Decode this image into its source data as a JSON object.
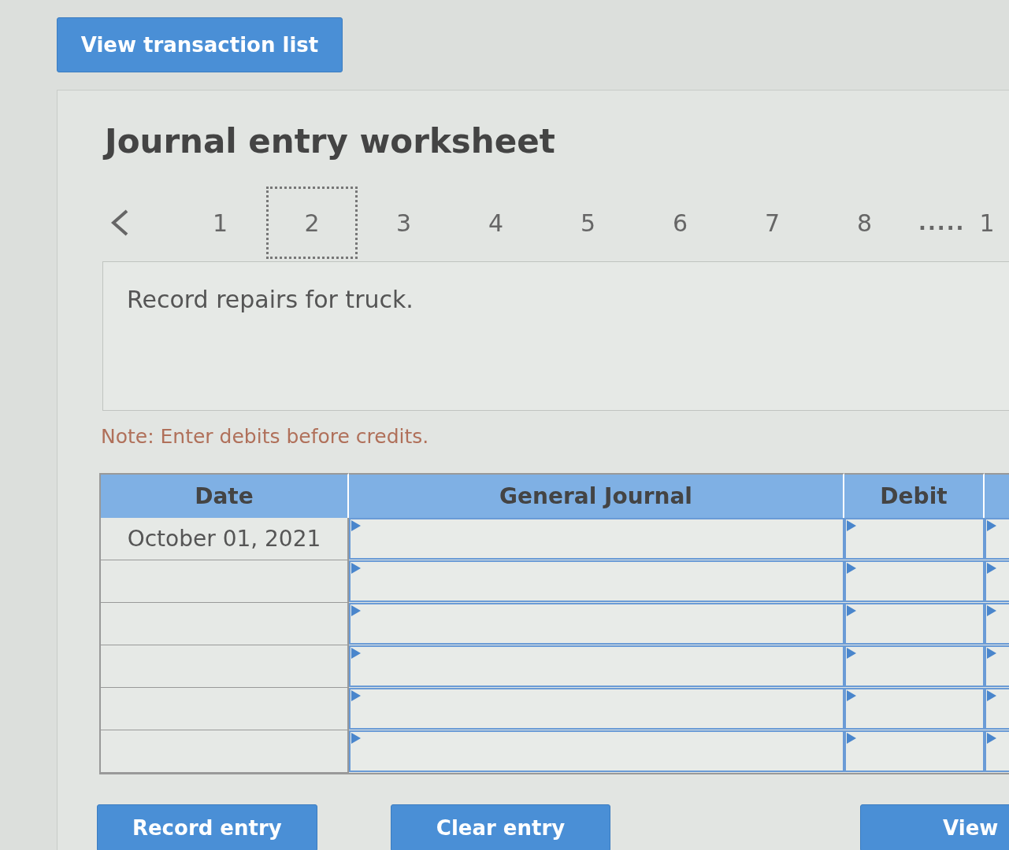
{
  "top_button": "View transaction list",
  "title": "Journal entry worksheet",
  "pager": {
    "items": [
      {
        "label": "1",
        "selected": false
      },
      {
        "label": "2",
        "selected": true
      },
      {
        "label": "3",
        "selected": false
      },
      {
        "label": "4",
        "selected": false
      },
      {
        "label": "5",
        "selected": false
      },
      {
        "label": "6",
        "selected": false
      },
      {
        "label": "7",
        "selected": false
      },
      {
        "label": "8",
        "selected": false
      }
    ],
    "ellipsis": ".....",
    "last": "1"
  },
  "description": "Record repairs for truck.",
  "note": "Note: Enter debits before credits.",
  "table": {
    "columns": [
      "Date",
      "General Journal",
      "Debit"
    ],
    "rows": [
      {
        "date": "October 01, 2021"
      },
      {},
      {},
      {},
      {},
      {}
    ]
  },
  "buttons": [
    "Record entry",
    "Clear entry",
    "View"
  ]
}
